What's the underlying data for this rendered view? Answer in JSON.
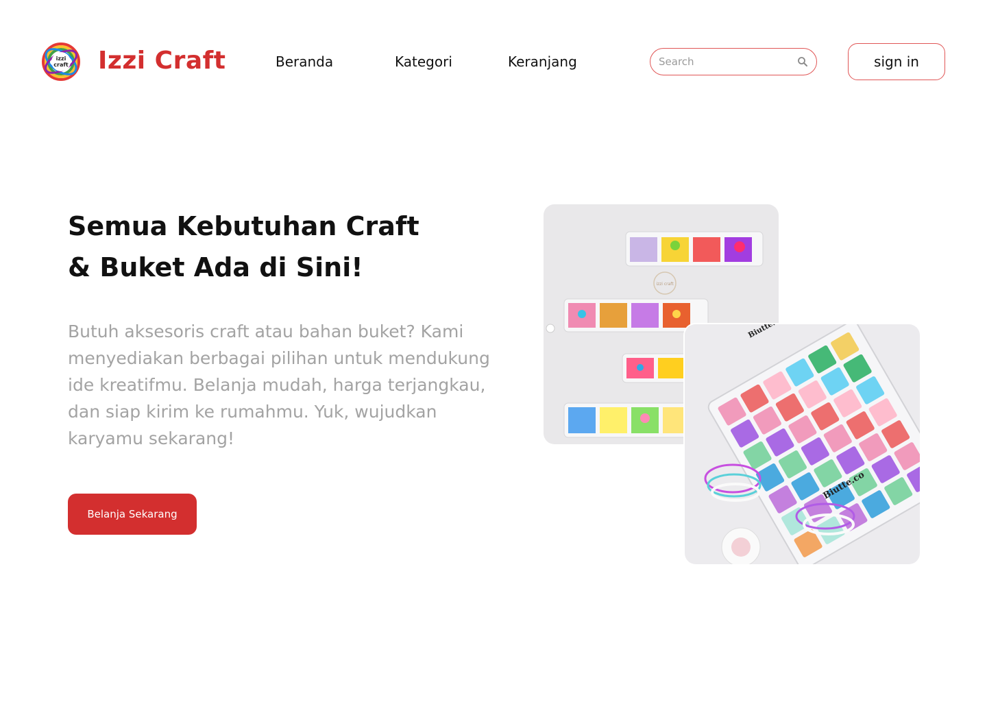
{
  "brand": {
    "name": "Izzi Craft",
    "logo_text_top": "izzi",
    "logo_text_bottom": "craft"
  },
  "nav": {
    "items": [
      {
        "label": "Beranda"
      },
      {
        "label": "Kategori"
      },
      {
        "label": "Keranjang"
      }
    ]
  },
  "search": {
    "placeholder": "Search",
    "icon": "search-icon"
  },
  "auth": {
    "signin_label": "sign in"
  },
  "hero": {
    "title_line1": "Semua Kebutuhan Craft",
    "title_line2": "& Buket Ada di Sini!",
    "description": "Butuh aksesoris craft atau bahan buket? Kami menyediakan berbagai pilihan untuk mendukung ide kreatifmu. Belanja mudah, harga terjangkau, dan siap kirim ke rumahmu. Yuk, wujudkan karyamu sekarang!",
    "cta_label": "Belanja Sekarang"
  },
  "images": {
    "photo1_label": "izzi craft",
    "photo2_brand": "Biutte.co"
  },
  "colors": {
    "brand": "#d32f2f",
    "border_accent": "#e05555",
    "muted_text": "#a3a3a3"
  }
}
